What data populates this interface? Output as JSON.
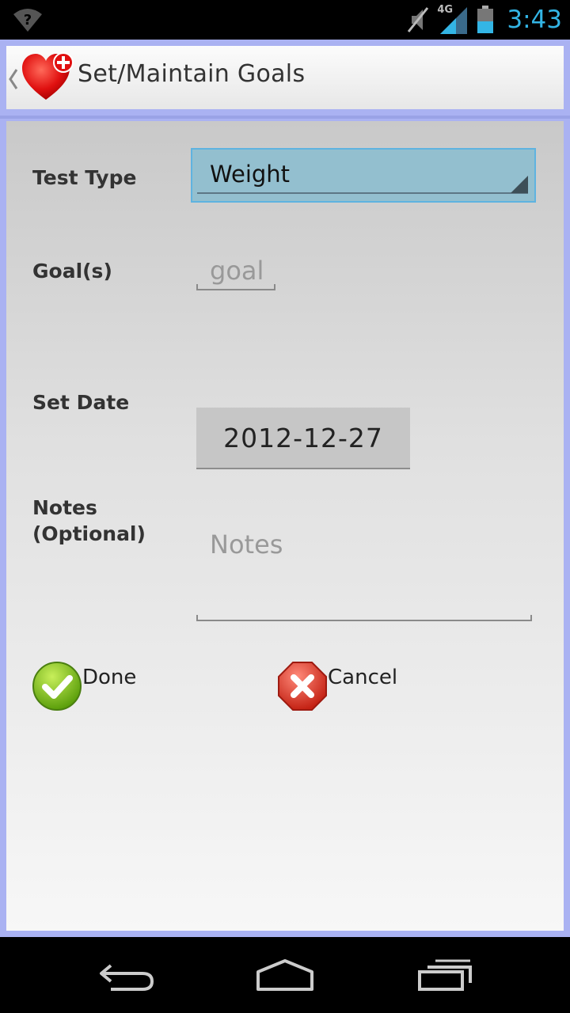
{
  "status_bar": {
    "time": "3:43",
    "network": "4G",
    "icons": [
      "wifi-unknown-icon",
      "mute-icon",
      "signal-icon",
      "battery-icon"
    ],
    "time_color": "#33b5e5"
  },
  "action_bar": {
    "title": "Set/Maintain Goals",
    "logo": "heart-plus-icon",
    "up_icon": "chevron-left-icon"
  },
  "form": {
    "test_type_label": "Test Type",
    "test_type_value": "Weight",
    "goal_label": "Goal(s)",
    "goal_placeholder": "goal",
    "set_date_label": "Set Date",
    "set_date_value": "2012-12-27",
    "notes_label_line1": "Notes",
    "notes_label_line2": "(Optional)",
    "notes_placeholder": "Notes"
  },
  "actions": {
    "done_label": "Done",
    "cancel_label": "Cancel",
    "done_icon": "check-circle-icon",
    "cancel_icon": "x-octagon-icon"
  },
  "nav_bar": {
    "buttons": [
      "back-icon",
      "home-icon",
      "recent-apps-icon"
    ]
  },
  "colors": {
    "frame": "#aab2f2",
    "spinner_bg": "#93bfcf",
    "spinner_border": "#5fb3e0"
  }
}
